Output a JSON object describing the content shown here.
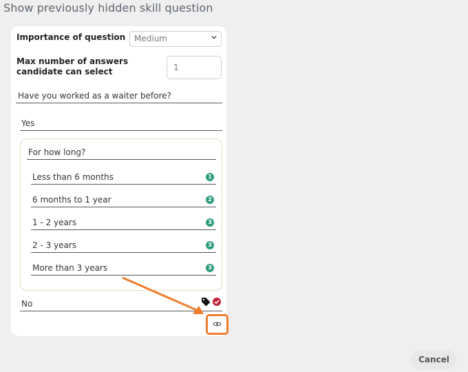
{
  "page": {
    "title": "Show previously hidden skill question"
  },
  "form": {
    "importance_label": "Importance of question",
    "importance_value": "Medium",
    "max_answers_label": "Max number of answers candidate can select",
    "max_answers_value": "1",
    "question": "Have you worked as a waiter before?",
    "answers": [
      {
        "text": "Yes",
        "followup": {
          "question": "For how long?",
          "options": [
            {
              "text": "Less than 6 months",
              "score": "1"
            },
            {
              "text": "6 months to 1 year",
              "score": "2"
            },
            {
              "text": "1 - 2 years",
              "score": "3"
            },
            {
              "text": "2 - 3 years",
              "score": "3"
            },
            {
              "text": "More than 3 years",
              "score": "3"
            }
          ]
        }
      },
      {
        "text": "No",
        "icons": [
          "tag-icon",
          "check-circle-icon"
        ]
      }
    ],
    "show_hidden_icon": "eye-icon"
  },
  "footer": {
    "cancel_label": "Cancel"
  },
  "colors": {
    "accent_highlight": "#ef7d2d",
    "score_badge": "#2e9c7f",
    "check": "#c0223b",
    "followup_border": "#e3dcc0"
  }
}
